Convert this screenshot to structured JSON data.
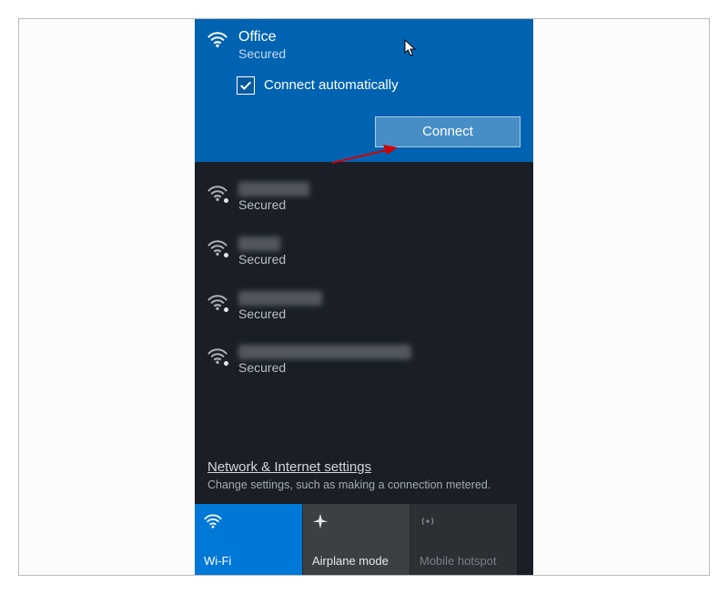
{
  "selected_network": {
    "name": "Office",
    "status": "Secured",
    "auto_connect_label": "Connect automatically",
    "auto_connect_checked": true,
    "connect_button": "Connect"
  },
  "networks": [
    {
      "status": "Secured",
      "name_redacted": true
    },
    {
      "status": "Secured",
      "name_redacted": true
    },
    {
      "status": "Secured",
      "name_redacted": true
    },
    {
      "status": "Secured",
      "name_redacted": true
    }
  ],
  "settings": {
    "link": "Network & Internet settings",
    "description": "Change settings, such as making a connection metered."
  },
  "tiles": {
    "wifi": "Wi-Fi",
    "airplane": "Airplane mode",
    "hotspot": "Mobile hotspot"
  }
}
